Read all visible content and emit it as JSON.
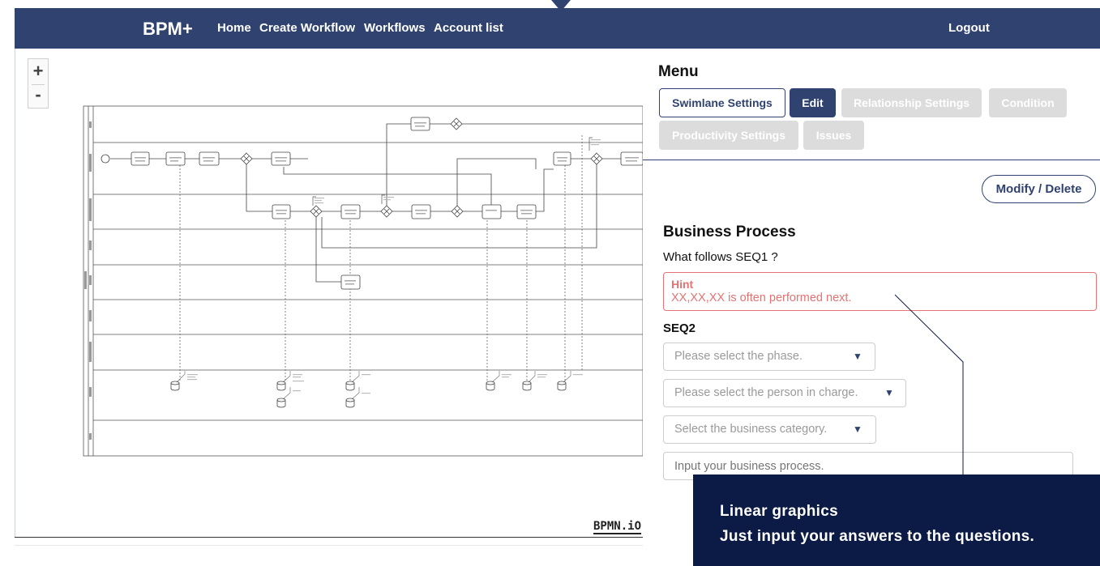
{
  "header": {
    "brand": "BPM+",
    "nav": [
      "Home",
      "Create Workflow",
      "Workflows",
      "Account list"
    ],
    "logout": "Logout",
    "bg_color": "#2f4270"
  },
  "canvas": {
    "zoom_in": "+",
    "zoom_out": "-",
    "logo": "BPMN.iO"
  },
  "panel": {
    "menu_title": "Menu",
    "buttons": {
      "swimlane": "Swimlane Settings",
      "edit": "Edit",
      "relationship": "Relationship Settings",
      "condition": "Condition",
      "productivity": "Productivity Settings",
      "issues": "Issues"
    },
    "modify": "Modify / Delete",
    "bp_title": "Business Process",
    "question": "What follows SEQ1 ?",
    "hint_title": "Hint",
    "hint_text": "XX,XX,XX is often performed next.",
    "seq_label": "SEQ2",
    "phase": "Please select the phase.",
    "person": "Please select the person in charge.",
    "category": "Select the business category.",
    "process_placeholder": "Input your business process.",
    "hint_color": "#e57373"
  },
  "callout": {
    "line1": "Linear graphics",
    "line2": "Just input your answers to the questions.",
    "bg_color": "#0c1a46"
  }
}
